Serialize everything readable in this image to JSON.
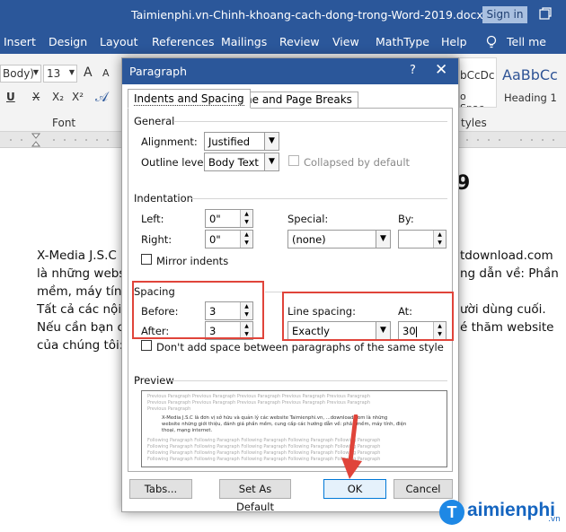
{
  "window": {
    "title": "Taimienphi.vn-Chinh-khoang-cach-dong-trong-Word-2019.docx - Word",
    "signin": "Sign in"
  },
  "ribbon_tabs": [
    "Insert",
    "Design",
    "Layout",
    "References",
    "Mailings",
    "Review",
    "View",
    "MathType",
    "Help"
  ],
  "tell_me": "Tell me",
  "ribbon": {
    "font_name": "Body)",
    "font_size": "13",
    "grow": "A",
    "shrink": "A",
    "underline": "U",
    "strike": "X",
    "sub": "X₂",
    "sup": "X²",
    "font_group": "Font",
    "style1": "bCcDc",
    "style1_name": "o Spac...",
    "style2": "AaBbCc",
    "style2_name": "Heading 1",
    "styles_group": "tyles"
  },
  "doc": {
    "lines_left": [
      "X-Media J.S.C l",
      "là những webs",
      "mềm, máy tính",
      "Tất cả các nội",
      "Nếu cần bạn c",
      "của chúng tôi:"
    ],
    "lines_right": [
      "tdownload.com",
      "ng dẫn về: Phần",
      "",
      "ười dùng cuối.",
      "é thăm website",
      ""
    ],
    "heading_tail": "9"
  },
  "dialog": {
    "title": "Paragraph",
    "help": "?",
    "close": "✕",
    "tab_indents": "Indents and Spacing",
    "tab_breaks": "Line and Page Breaks",
    "general": "General",
    "alignment_label": "Alignment:",
    "alignment_value": "Justified",
    "outline_label": "Outline level:",
    "outline_value": "Body Text",
    "collapsed_label": "Collapsed by default",
    "indentation": "Indentation",
    "left_label": "Left:",
    "left_value": "0\"",
    "right_label": "Right:",
    "right_value": "0\"",
    "special_label": "Special:",
    "special_value": "(none)",
    "by_label": "By:",
    "by_value": "",
    "mirror_label": "Mirror indents",
    "spacing": "Spacing",
    "before_label": "Before:",
    "before_value": "3",
    "after_label": "After:",
    "after_value": "3",
    "line_spacing_label": "Line spacing:",
    "line_spacing_value": "Exactly",
    "at_label": "At:",
    "at_value": "30",
    "dont_add_label": "Don't add space between paragraphs of the same style",
    "preview": "Preview",
    "preview_text": [
      "Previous Paragraph Previous Paragraph Previous Paragraph Previous Paragraph Previous Paragraph",
      "Previous Paragraph Previous Paragraph Previous Paragraph Previous Paragraph Previous Paragraph",
      "Previous Paragraph",
      "X-Media J.S.C là đơn vị sở hữu và quản lý các website Taimienphi.vn, ...download.com là những",
      "website những giới thiệu, đánh giá phần mềm, cung cấp các hướng dẫn về: phần mềm, máy tính, điện",
      "thoại, mạng internet.",
      "Following Paragraph Following Paragraph Following Paragraph Following Paragraph Following Paragraph",
      "Following Paragraph Following Paragraph Following Paragraph Following Paragraph Following Paragraph",
      "Following Paragraph Following Paragraph Following Paragraph Following Paragraph Following Paragraph",
      "Following Paragraph Following Paragraph Following Paragraph Following Paragraph Following Paragraph"
    ],
    "tabs_button": "Tabs...",
    "default_button": "Set As Default",
    "ok_button": "OK",
    "cancel_button": "Cancel"
  },
  "watermark": "aimienphi",
  "watermark_initial": "T",
  "watermark_sub": ".vn",
  "colors": {
    "word_blue": "#2b579a",
    "highlight_red": "#e0443a",
    "ok_blue": "#0078d7"
  }
}
